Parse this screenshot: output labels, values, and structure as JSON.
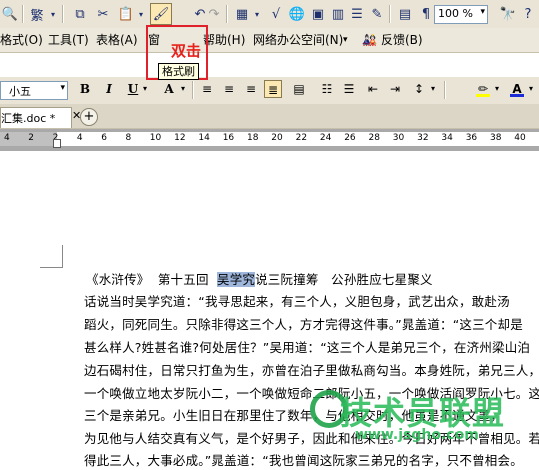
{
  "toolbar": {
    "special_char": "繁",
    "zoom": "100 %",
    "annotation": "双击",
    "tooltip": "格式刷"
  },
  "menu": {
    "items": [
      "格式(O)",
      "工具(T)",
      "表格(A)",
      "窗",
      "帮助(H)",
      "网络办公空间(N)",
      "反馈(B)"
    ]
  },
  "format": {
    "font_size": "小五"
  },
  "tab": {
    "label": "汇集.doc *"
  },
  "ruler": {
    "labels": [
      "4",
      "2",
      "2",
      "4",
      "6",
      "8",
      "10",
      "12",
      "14",
      "16",
      "18",
      "20",
      "22",
      "24",
      "26",
      "28",
      "30",
      "32",
      "34",
      "36",
      "38",
      "40"
    ]
  },
  "document": {
    "title_pre": "《水浒传》  第十五回  ",
    "title_sel": "吴学究",
    "title_post": "说三阮撞筹   公孙胜应七星聚义",
    "lines": [
      "话说当时吴学究道：“我寻思起来，有三个人，义胆包身，武艺出众，敢赴汤",
      "蹈火，同死同生。只除非得这三个人，方才完得这件事。”晁盖道：“这三个却是",
      "甚么样人?姓甚名谁?何处居住？”吴用道：“这三个人是弟兄三个，在济州梁山泊",
      "边石碣村住，日常只打鱼为生，亦曾在泊子里做私商勾当。本身姓阮，弟兄三人，",
      "一个唤做立地太岁阮小二，一个唤做短命二郎阮小五，一个唤做活阎罗阮小七。这",
      "三个是亲弟兄。小生旧日在那里住了数年，与他相交时，他虽是不通文墨，",
      "为见他与人结交真有义气，是个好男子，因此和他来往。今日好两年不曾相见。若",
      "得此三人，大事必成。”晁盖道：“我也曾闻这阮家三弟兄的名字，只不曾相会。"
    ]
  },
  "watermark": {
    "text": "技术员联盟",
    "url": "www.jsgho.com"
  }
}
